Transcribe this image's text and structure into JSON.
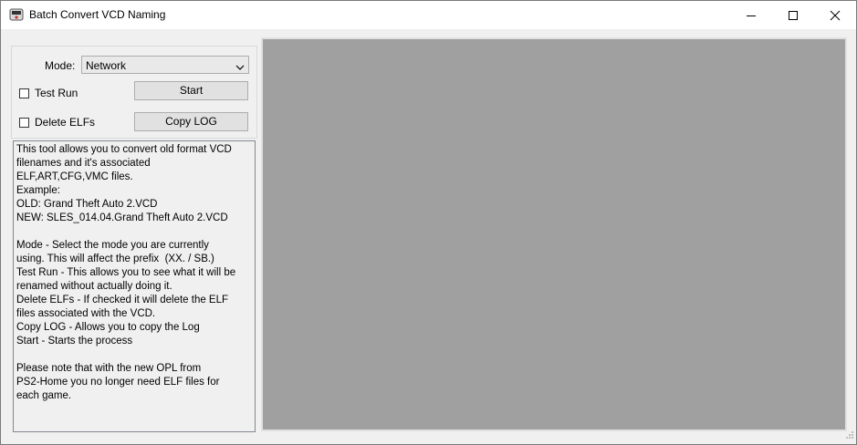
{
  "window": {
    "title": "Batch Convert VCD Naming"
  },
  "controls": {
    "mode_label": "Mode:",
    "mode_value": "Network",
    "test_run_label": "Test Run",
    "test_run_checked": false,
    "delete_elfs_label": "Delete ELFs",
    "delete_elfs_checked": false,
    "start_button": "Start",
    "copy_log_button": "Copy LOG"
  },
  "info_text": "This tool allows you to convert old format VCD\nfilenames and it's associated\nELF,ART,CFG,VMC files.\nExample:\nOLD: Grand Theft Auto 2.VCD\nNEW: SLES_014.04.Grand Theft Auto 2.VCD\n\nMode - Select the mode you are currently\nusing. This will affect the prefix  (XX. / SB.)\nTest Run - This allows you to see what it will be\nrenamed without actually doing it.\nDelete ELFs - If checked it will delete the ELF\nfiles associated with the VCD.\nCopy LOG - Allows you to copy the Log\nStart - Starts the process\n\nPlease note that with the new OPL from\nPS2-Home you no longer need ELF files for\neach game.",
  "log": {
    "content": ""
  }
}
